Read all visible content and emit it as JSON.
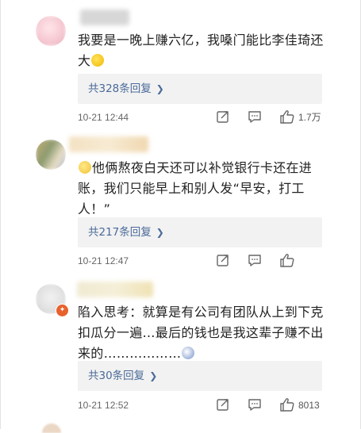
{
  "comments": [
    {
      "text": "我要是一晚上赚六亿，我嗓门能比李佳琦还大",
      "replies_label": "共328条回复",
      "time": "10-21 12:44",
      "likes": "1.7万"
    },
    {
      "text": "他俩熬夜白天还可以补觉银行卡还在进账，我们只能早上和别人发“早安，打工人！”",
      "replies_label": "共217条回复",
      "time": "10-21 12:47",
      "likes": ""
    },
    {
      "text": "陷入思考：就算是有公司有团队从上到下克扣瓜分一遍…最后的钱也是我这辈子赚不出来的………………",
      "replies_label": "共30条回复",
      "time": "10-21 12:52",
      "likes": "8013"
    }
  ],
  "icons": {
    "forward": "share-edit-icon",
    "comment": "comment-icon",
    "like": "thumbs-up-icon",
    "reply_chevron": "chevron-right-icon"
  },
  "colors": {
    "link": "#4a6a99",
    "reply_box": "#f2f2f2",
    "text": "#222222",
    "meta": "#666666"
  }
}
